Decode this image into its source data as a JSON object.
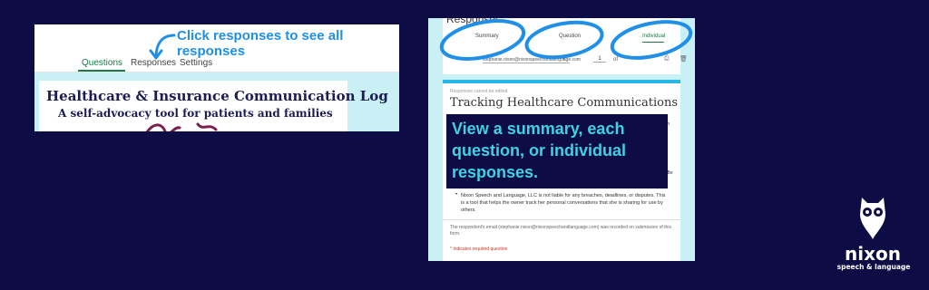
{
  "left_panel": {
    "tabs": {
      "questions": "Questions",
      "responses": "Responses",
      "settings": "Settings"
    },
    "callout": "Click responses to see all responses",
    "document": {
      "title": "Healthcare & Insurance Communication Log",
      "subtitle": "A self-advocacy tool for patients and families"
    }
  },
  "right_panel": {
    "heading": "Responses",
    "tabs": {
      "summary": "Summary",
      "question": "Question",
      "individual": "Individual"
    },
    "respondent_email": "stephanie.nixon@nixonspeechandlanguage.com",
    "page_number": "1",
    "page_of": "of",
    "cannot_edit": "Responses cannot be edited",
    "form_title": "Tracking Healthcare Communications",
    "overlay_text": "View a summary, each question, or individual responses.",
    "fragments": {
      "form": "form",
      "be": "g. Be",
      "ve": "ve"
    },
    "bullet": "Nixon Speech and Language, LLC is not liable for any breaches, deadlines, or disputes. This is a tool that helps the owner track her personal conversations that she is sharing for use by others.",
    "email_note": "The respondent's email (stephanie.nixon@nixonspeechandlanguage.com) was recorded on submission of this form.",
    "required_note": "* Indicates required question"
  },
  "logo": {
    "name": "nixon",
    "tagline": "speech & language"
  },
  "colors": {
    "background": "#0d0c44",
    "accent_blue": "#1f8fe8",
    "overlay_text": "#3fd2e5",
    "panel_bg": "#c9f0f4"
  }
}
